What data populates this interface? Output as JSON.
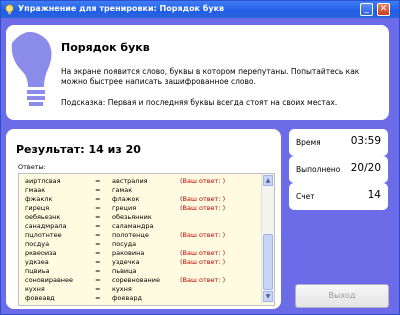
{
  "window": {
    "title": "Упражнение для тренировки: Порядок букв",
    "minimize_glyph": "_",
    "close_glyph": "✕"
  },
  "intro": {
    "title": "Порядок букв",
    "description": "На экране появится слово, буквы в котором перепутаны. Попытайтесь как можно быстрее написать зашифрованное слово.",
    "hint": "Подсказка: Первая и последняя буквы всегда стоят на своих местах.",
    "icon": "lightbulb-icon"
  },
  "result": {
    "title": "Результат: 14 из 20",
    "answers_label": "Ответы:",
    "answers": [
      {
        "scrambled": "аиртлсвая",
        "eq": "=",
        "word": "австралия",
        "note": "(Ваш ответ: )"
      },
      {
        "scrambled": "гмаак",
        "eq": "=",
        "word": "гамак",
        "note": ""
      },
      {
        "scrambled": "фжаклк",
        "eq": "=",
        "word": "флажок",
        "note": "(Ваш ответ: )"
      },
      {
        "scrambled": "гиреця",
        "eq": "=",
        "word": "греция",
        "note": "(Ваш ответ: )"
      },
      {
        "scrambled": "оебяьезнк",
        "eq": "=",
        "word": "обезьянник",
        "note": ""
      },
      {
        "scrambled": "санадмрала",
        "eq": "=",
        "word": "саламандра",
        "note": ""
      },
      {
        "scrambled": "пцлотнтее",
        "eq": "=",
        "word": "полотенце",
        "note": "(Ваш ответ: )"
      },
      {
        "scrambled": "посдуа",
        "eq": "=",
        "word": "посуда",
        "note": ""
      },
      {
        "scrambled": "рквеоиза",
        "eq": "=",
        "word": "раковина",
        "note": "(Ваш ответ: )"
      },
      {
        "scrambled": "удкзеа",
        "eq": "=",
        "word": "уздечка",
        "note": "(Ваш ответ: )"
      },
      {
        "scrambled": "пцвиьа",
        "eq": "=",
        "word": "пьвица",
        "note": ""
      },
      {
        "scrambled": "соновиравнее",
        "eq": "=",
        "word": "соревнование",
        "note": "(Ваш ответ: )"
      },
      {
        "scrambled": "кухня",
        "eq": "=",
        "word": "кухня",
        "note": ""
      },
      {
        "scrambled": "фовеавд",
        "eq": "=",
        "word": "фоевард",
        "note": ""
      }
    ]
  },
  "stats": {
    "time_label": "Время",
    "time_value": "03:59",
    "done_label": "Выполнено",
    "done_value": "20/20",
    "score_label": "Счет",
    "score_value": "14"
  },
  "exit_button": "Выход",
  "colors": {
    "background": "#6c6ce8",
    "titlebar": "#1f5ee6",
    "answer_note": "#c00000",
    "list_background": "#fffbe0"
  }
}
